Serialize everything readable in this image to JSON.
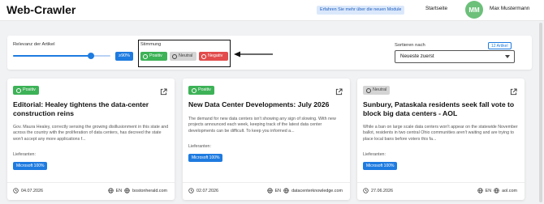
{
  "header": {
    "app_title": "Web-Crawler",
    "news_link": "Erfahren Sie mehr über die neuen Module",
    "nav_home": "Startseite",
    "avatar_initials": "MM",
    "user_name": "Max Mustermann"
  },
  "filters": {
    "relevance_label": "Relevanz der Artikel",
    "relevance_value": "≥90%",
    "relevance_level_fraction": 0.8,
    "mood_label": "Stimmung",
    "mood_positive": "Positiv",
    "mood_neutral": "Neutral",
    "mood_negative": "Negativ",
    "sort_label": "Sortieren nach",
    "article_count": "12 Artikel",
    "sort_value": "Neueste zuerst"
  },
  "cards": [
    {
      "sentiment": "Positiv",
      "title": "Editorial: Healey tightens the data-center construction reins",
      "excerpt": "Gov. Maura Healey, correctly sensing the growing disillusionment in this state and across the country with the proliferation of data centers, has decreed the state won't accept any more applications f...",
      "suppliers_label": "Lieferanten:",
      "supplier": "Microsoft 100%",
      "date": "04.07.2026",
      "lang": "EN",
      "domain": "bostonherald.com"
    },
    {
      "sentiment": "Positiv",
      "title": "New Data Center Developments: July 2026",
      "excerpt": "The demand for new data centers isn't showing any sign of slowing. With new projects announced each week, keeping track of the latest data center developments can be difficult. To keep you informed a...",
      "suppliers_label": "Lieferanten:",
      "supplier": "Microsoft 100%",
      "date": "02.07.2026",
      "lang": "EN",
      "domain": "datacenterknowledge.com"
    },
    {
      "sentiment": "Neutral",
      "title": "Sunbury, Pataskala residents seek fall vote to block big data centers - AOL",
      "excerpt": "While a ban on large scale data centers won't appear on the statewide November ballot, residents in two central Ohio communities aren't waiting and are trying to place local bans before voters this fa...",
      "suppliers_label": "Lieferanten:",
      "supplier": "Microsoft 100%",
      "date": "27.06.2026",
      "lang": "EN",
      "domain": "aol.com"
    }
  ]
}
